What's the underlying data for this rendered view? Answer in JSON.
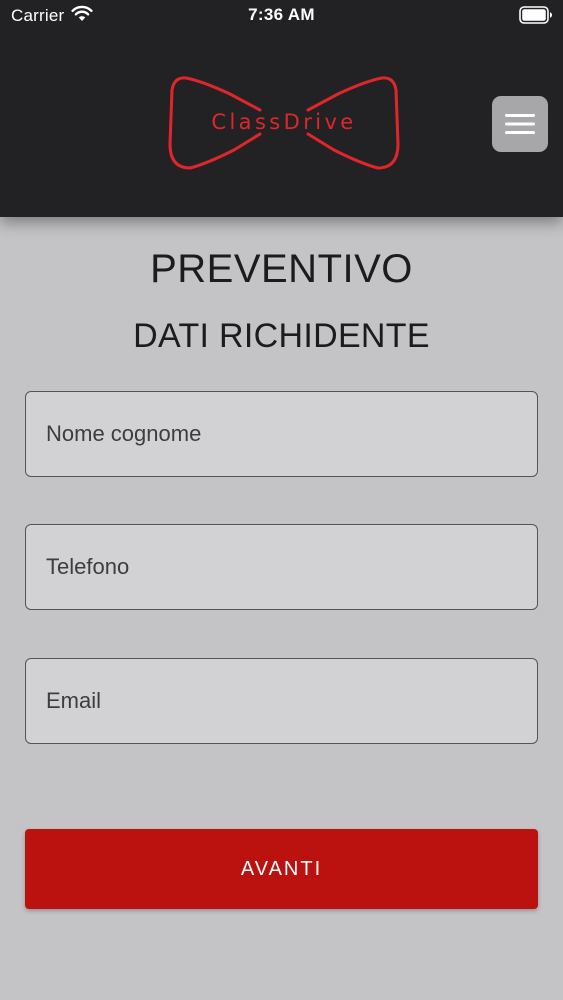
{
  "status_bar": {
    "carrier": "Carrier",
    "time": "7:36 AM",
    "wifi_icon": "wifi-icon",
    "battery_icon": "battery-full-icon"
  },
  "header": {
    "logo_text": "ClassDrive",
    "logo_color": "#e0262a",
    "menu_icon": "hamburger-menu-icon",
    "background_color": "#222224"
  },
  "page": {
    "title": "PREVENTIVO",
    "section_title": "DATI RICHIDENTE"
  },
  "form": {
    "name": {
      "placeholder": "Nome cognome",
      "value": ""
    },
    "phone": {
      "placeholder": "Telefono",
      "value": ""
    },
    "email": {
      "placeholder": "Email",
      "value": ""
    }
  },
  "actions": {
    "next_label": "AVANTI",
    "next_color": "#bb1210"
  }
}
